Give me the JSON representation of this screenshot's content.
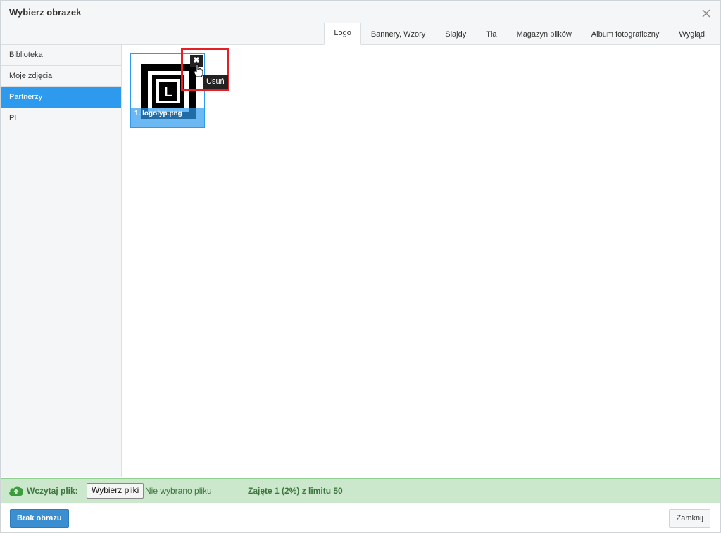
{
  "dialog": {
    "title": "Wybierz obrazek"
  },
  "tabs": [
    {
      "label": "Logo",
      "active": true
    },
    {
      "label": "Bannery, Wzory"
    },
    {
      "label": "Slajdy"
    },
    {
      "label": "Tła"
    },
    {
      "label": "Magazyn plików"
    },
    {
      "label": "Album fotograficzny"
    },
    {
      "label": "Wygląd"
    }
  ],
  "sidebar": {
    "items": [
      {
        "label": "Biblioteka"
      },
      {
        "label": "Moje zdjęcia"
      },
      {
        "label": "Partnerzy",
        "active": true
      },
      {
        "label": "PL"
      }
    ]
  },
  "gallery": {
    "items": [
      {
        "caption": "1. logolyp.png",
        "logo_letter": "L"
      }
    ],
    "delete_tooltip": "Usuń",
    "delete_glyph": "✖"
  },
  "upload": {
    "label": "Wczytaj plik:",
    "choose_button": "Wybierz pliki",
    "no_file": "Nie wybrano pliku",
    "usage": "Zajęte 1 (2%) z limitu 50"
  },
  "footer": {
    "no_image_button": "Brak obrazu",
    "close_button": "Zamknij"
  },
  "colors": {
    "accent": "#2d9aee",
    "upload_bg": "#cce8cc",
    "upload_text": "#3c763d",
    "highlight": "#e41f26"
  }
}
